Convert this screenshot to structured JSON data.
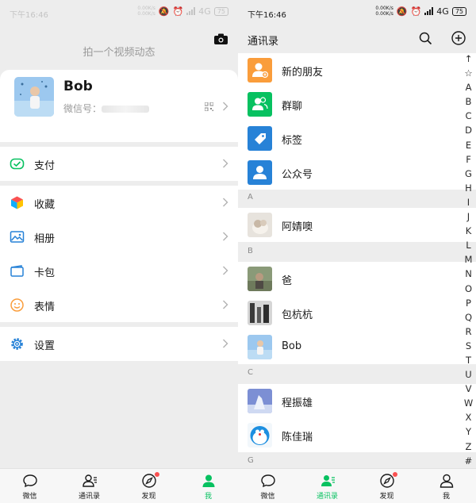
{
  "left": {
    "status": {
      "time": "下午16:46",
      "net_up": "0.00K/s",
      "net_down": "0.00K/s",
      "signal": "4G",
      "battery": "75"
    },
    "moments_hint": "拍一个视频动态",
    "profile": {
      "name": "Bob",
      "wechat_id_label": "微信号："
    },
    "menu": {
      "pay": "支付",
      "favorites": "收藏",
      "album": "相册",
      "cards": "卡包",
      "stickers": "表情",
      "settings": "设置"
    }
  },
  "right": {
    "status": {
      "time": "下午16:46",
      "net_up": "0.00K/s",
      "net_down": "0.00K/s",
      "signal": "4G",
      "battery": "75"
    },
    "title": "通讯录",
    "special": {
      "new_friends": "新的朋友",
      "group_chats": "群聊",
      "tags": "标签",
      "official_accounts": "公众号"
    },
    "sections": {
      "a": {
        "header": "A",
        "contacts": [
          "阿婧噢"
        ]
      },
      "b": {
        "header": "B",
        "contacts": [
          "爸",
          "包杭杭",
          "Bob"
        ]
      },
      "c": {
        "header": "C",
        "contacts": [
          "程振雄",
          "陈佳瑞"
        ]
      },
      "g": {
        "header": "G"
      }
    },
    "index": [
      "↑",
      "☆",
      "A",
      "B",
      "C",
      "D",
      "E",
      "F",
      "G",
      "H",
      "I",
      "J",
      "K",
      "L",
      "M",
      "N",
      "O",
      "P",
      "Q",
      "R",
      "S",
      "T",
      "U",
      "V",
      "W",
      "X",
      "Y",
      "Z",
      "#"
    ]
  },
  "tabs": {
    "chats": "微信",
    "contacts": "通讯录",
    "discover": "发现",
    "me": "我"
  },
  "colors": {
    "brand_green": "#07c160",
    "badge_red": "#fa5151",
    "orange": "#fa9d3b",
    "blue": "#2782d7"
  }
}
